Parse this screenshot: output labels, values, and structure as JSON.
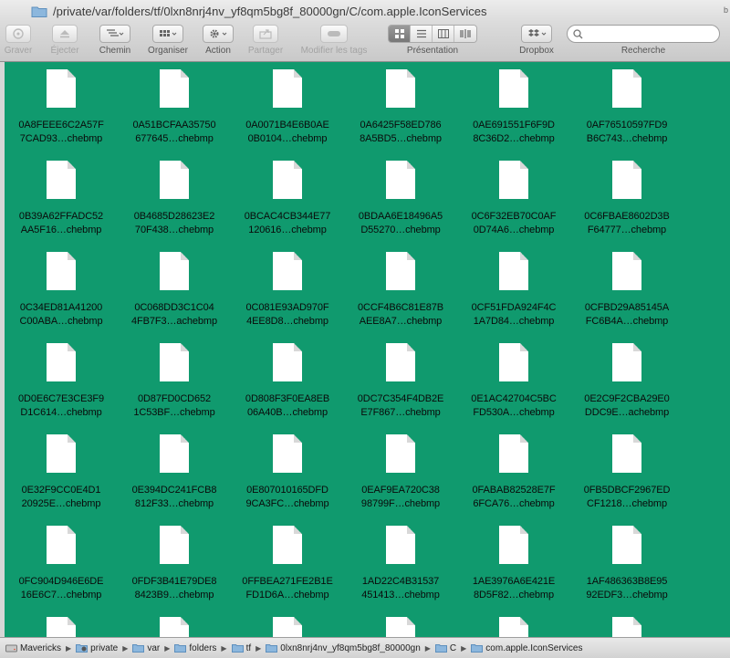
{
  "window": {
    "title": "/private/var/folders/tf/0lxn8nrj4nv_yf8qm5bg8f_80000gn/C/com.apple.IconServices",
    "cut_text": "b"
  },
  "toolbar": {
    "burn_label": "Graver",
    "eject_label": "Éjecter",
    "path_label": "Chemin",
    "arrange_label": "Organiser",
    "action_label": "Action",
    "share_label": "Partager",
    "edit_tags_label": "Modifier les tags",
    "view_label": "Présentation",
    "dropbox_label": "Dropbox",
    "search_label": "Recherche",
    "search_placeholder": ""
  },
  "files": [
    {
      "line1": "0A8FEEE6C2A57F",
      "line2": "7CAD93…chebmp"
    },
    {
      "line1": "0A51BCFAA35750",
      "line2": "677645…chebmp"
    },
    {
      "line1": "0A0071B4E6B0AE",
      "line2": "0B0104…chebmp"
    },
    {
      "line1": "0A6425F58ED786",
      "line2": "8A5BD5…chebmp"
    },
    {
      "line1": "0AE691551F6F9D",
      "line2": "8C36D2…chebmp"
    },
    {
      "line1": "0AF76510597FD9",
      "line2": "B6C743…chebmp"
    },
    {
      "line1": "0B39A62FFADC52",
      "line2": "AA5F16…chebmp"
    },
    {
      "line1": "0B4685D28623E2",
      "line2": "70F438…chebmp"
    },
    {
      "line1": "0BCAC4CB344E77",
      "line2": "120616…chebmp"
    },
    {
      "line1": "0BDAA6E18496A5",
      "line2": "D55270…chebmp"
    },
    {
      "line1": "0C6F32EB70C0AF",
      "line2": "0D74A6…chebmp"
    },
    {
      "line1": "0C6FBAE8602D3B",
      "line2": "F64777…chebmp"
    },
    {
      "line1": "0C34ED81A41200",
      "line2": "C00ABA…chebmp"
    },
    {
      "line1": "0C068DD3C1C04",
      "line2": "4FB7F3…achebmp"
    },
    {
      "line1": "0C081E93AD970F",
      "line2": "4EE8D8…chebmp"
    },
    {
      "line1": "0CCF4B6C81E87B",
      "line2": "AEE8A7…chebmp"
    },
    {
      "line1": "0CF51FDA924F4C",
      "line2": "1A7D84…chebmp"
    },
    {
      "line1": "0CFBD29A85145A",
      "line2": "FC6B4A…chebmp"
    },
    {
      "line1": "0D0E6C7E3CE3F9",
      "line2": "D1C614…chebmp"
    },
    {
      "line1": "0D87FD0CD652",
      "line2": "1C53BF…chebmp"
    },
    {
      "line1": "0D808F3F0EA8EB",
      "line2": "06A40B…chebmp"
    },
    {
      "line1": "0DC7C354F4DB2E",
      "line2": "E7F867…chebmp"
    },
    {
      "line1": "0E1AC42704C5BC",
      "line2": "FD530A…chebmp"
    },
    {
      "line1": "0E2C9F2CBA29E0",
      "line2": "DDC9E…achebmp"
    },
    {
      "line1": "0E32F9CC0E4D1",
      "line2": "20925E…chebmp"
    },
    {
      "line1": "0E394DC241FCB8",
      "line2": "812F33…chebmp"
    },
    {
      "line1": "0E807010165DFD",
      "line2": "9CA3FC…chebmp"
    },
    {
      "line1": "0EAF9EA720C38",
      "line2": "98799F…chebmp"
    },
    {
      "line1": "0FABAB82528E7F",
      "line2": "6FCA76…chebmp"
    },
    {
      "line1": "0FB5DBCF2967ED",
      "line2": "CF1218…chebmp"
    },
    {
      "line1": "0FC904D946E6DE",
      "line2": "16E6C7…chebmp"
    },
    {
      "line1": "0FDF3B41E79DE8",
      "line2": "8423B9…chebmp"
    },
    {
      "line1": "0FFBEA271FE2B1E",
      "line2": "FD1D6A…chebmp"
    },
    {
      "line1": "1AD22C4B31537",
      "line2": "451413…chebmp"
    },
    {
      "line1": "1AE3976A6E421E",
      "line2": "8D5F82…chebmp"
    },
    {
      "line1": "1AF486363B8E95",
      "line2": "92EDF3…chebmp"
    }
  ],
  "pathbar": {
    "crumbs": [
      {
        "label": "Mavericks",
        "icon": "disk-icon"
      },
      {
        "label": "private",
        "icon": "private-folder-icon"
      },
      {
        "label": "var",
        "icon": "folder-icon"
      },
      {
        "label": "folders",
        "icon": "folder-icon"
      },
      {
        "label": "tf",
        "icon": "folder-icon"
      },
      {
        "label": "0lxn8nrj4nv_yf8qm5bg8f_80000gn",
        "icon": "folder-icon"
      },
      {
        "label": "C",
        "icon": "folder-icon"
      },
      {
        "label": "com.apple.IconServices",
        "icon": "folder-icon"
      }
    ]
  },
  "colors": {
    "content_background": "#109a6e",
    "document_icon": "#ffffff"
  }
}
